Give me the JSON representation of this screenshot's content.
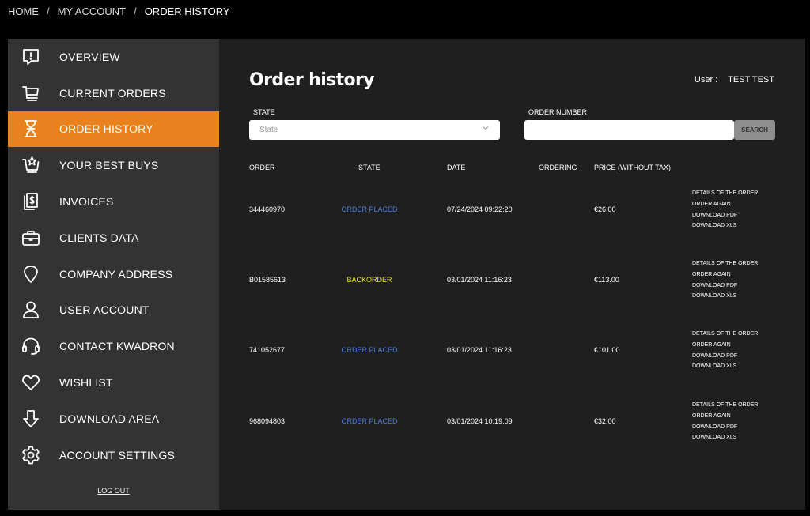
{
  "breadcrumb": {
    "home": "HOME",
    "account": "MY ACCOUNT",
    "current": "ORDER HISTORY",
    "sep": "/"
  },
  "sidebar": {
    "items": [
      {
        "label": "OVERVIEW",
        "icon": "alert-message-icon"
      },
      {
        "label": "CURRENT ORDERS",
        "icon": "cart-icon"
      },
      {
        "label": "ORDER HISTORY",
        "icon": "hourglass-icon",
        "active": true
      },
      {
        "label": "YOUR BEST BUYS",
        "icon": "cart-star-icon"
      },
      {
        "label": "INVOICES",
        "icon": "invoice-icon"
      },
      {
        "label": "CLIENTS DATA",
        "icon": "briefcase-icon"
      },
      {
        "label": "COMPANY ADDRESS",
        "icon": "map-pin-icon"
      },
      {
        "label": "USER ACCOUNT",
        "icon": "user-icon"
      },
      {
        "label": "CONTACT KWADRON",
        "icon": "headset-icon"
      },
      {
        "label": "WISHLIST",
        "icon": "heart-icon"
      },
      {
        "label": "DOWNLOAD AREA",
        "icon": "download-arrow-icon"
      },
      {
        "label": "ACCOUNT SETTINGS",
        "icon": "gear-icon"
      }
    ],
    "logout": "LOG OUT"
  },
  "main": {
    "title": "Order history",
    "user_label": "User :",
    "user_name": "TEST TEST",
    "filters": {
      "state_label": "STATE",
      "state_placeholder": "State",
      "order_number_label": "ORDER NUMBER",
      "order_number_value": "",
      "search_label": "SEARCH"
    },
    "table": {
      "headers": [
        "ORDER",
        "STATE",
        "DATE",
        "ORDERING",
        "PRICE (WITHOUT TAX)"
      ],
      "actions": [
        "DETAILS OF THE ORDER",
        "ORDER AGAIN",
        "DOWNLOAD PDF",
        "DOWNLOAD XLS"
      ],
      "rows": [
        {
          "order": "344460970",
          "state": "ORDER PLACED",
          "state_type": "placed",
          "date": "07/24/2024 09:22:20",
          "ordering": "",
          "price": "€26.00"
        },
        {
          "order": "B01585613",
          "state": "BACKORDER",
          "state_type": "backorder",
          "date": "03/01/2024 11:16:23",
          "ordering": "",
          "price": "€113.00"
        },
        {
          "order": "741052677",
          "state": "ORDER PLACED",
          "state_type": "placed",
          "date": "03/01/2024 11:16:23",
          "ordering": "",
          "price": "€101.00"
        },
        {
          "order": "968094803",
          "state": "ORDER PLACED",
          "state_type": "placed",
          "date": "03/01/2024 10:19:09",
          "ordering": "",
          "price": "€32.00"
        }
      ]
    }
  },
  "colors": {
    "accent": "#e8821e",
    "placed": "#4a7fd8",
    "backorder": "#e6e01a",
    "sidebar_bg": "#333333",
    "main_bg": "#1f1f1f"
  }
}
